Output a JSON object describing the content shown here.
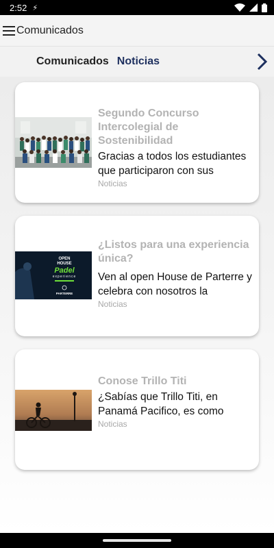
{
  "status": {
    "time": "2:52",
    "extra": "⚡"
  },
  "app_bar": {
    "title": "Comunicados"
  },
  "tabs": [
    {
      "label": "Comunicados",
      "active": true
    },
    {
      "label": "Noticias",
      "active": false
    }
  ],
  "cards": [
    {
      "title": "Segundo Concurso Intercolegial de Sostenibilidad",
      "body": "Gracias a todos los estudiantes que participaron con sus",
      "category": "Noticias",
      "image": "group-photo"
    },
    {
      "title": "¿Listos para una experiencia única?",
      "body": "Ven al open House de Parterre y celebra con nosotros la",
      "category": "Noticias",
      "image": "padel-poster",
      "poster": {
        "line1": "OPEN",
        "line2": "HOUSE",
        "line3": "Padel",
        "line4": "experience",
        "brand": "PARTERRE"
      }
    },
    {
      "title": "Conose Trillo Titi",
      "body": "¿Sabías que Trillo Titi, en Panamá Pacifico, es como",
      "category": "Noticias",
      "image": "cyclist-sunset"
    }
  ],
  "colors": {
    "accent": "#1d2f5e",
    "title_grey": "#b3b3b3",
    "padel_green": "#6fe03a"
  }
}
